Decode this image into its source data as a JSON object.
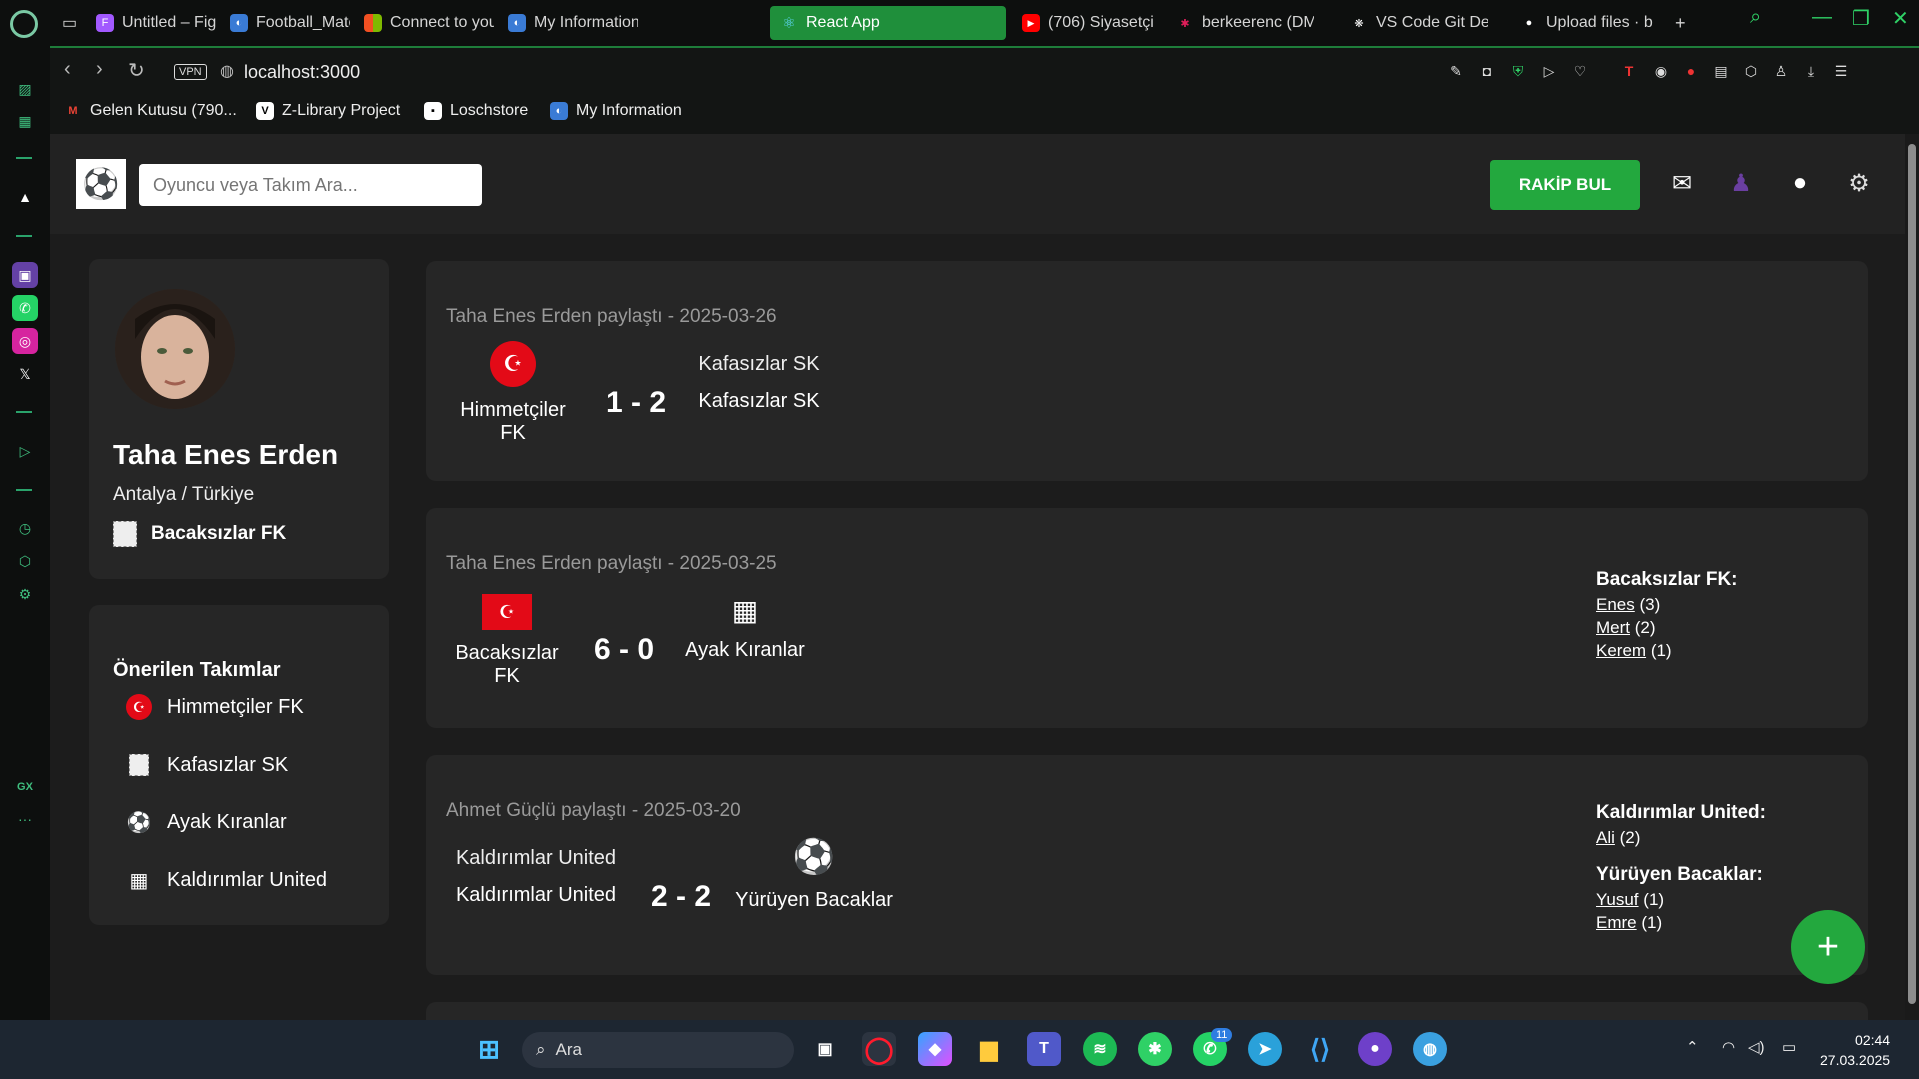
{
  "browser": {
    "tabs": [
      {
        "label": "Untitled – Figma",
        "icon": "figma-icon",
        "color": "#a259ff"
      },
      {
        "label": "Football_Match",
        "icon": "app-icon",
        "color": "#3a7bd5"
      },
      {
        "label": "Connect to you",
        "icon": "microsoft-icon",
        "color": "#f25022"
      },
      {
        "label": "My Information",
        "icon": "app-icon",
        "color": "#3a7bd5"
      },
      {
        "label": "React App",
        "icon": "react-icon",
        "color": "#61dafb"
      },
      {
        "label": "(706) Siyasetçi",
        "icon": "youtube-icon",
        "color": "#ff0000"
      },
      {
        "label": "berkeerenc (DM",
        "icon": "slack-icon",
        "color": "#e01e5a"
      },
      {
        "label": "VS Code Git De",
        "icon": "openai-icon",
        "color": "#ffffff"
      },
      {
        "label": "Upload files · b",
        "icon": "github-icon",
        "color": "#ffffff"
      }
    ],
    "url": "localhost:3000",
    "vpn_label": "VPN",
    "bookmarks": [
      {
        "label": "Gelen Kutusu (790...",
        "icon": "gmail-icon"
      },
      {
        "label": "Z-Library Project",
        "icon": "zlibrary-icon"
      },
      {
        "label": "Loschstore",
        "icon": "store-icon"
      },
      {
        "label": "My Information",
        "icon": "app-icon"
      }
    ],
    "sidebar_label": "GX"
  },
  "app": {
    "search_placeholder": "Oyuncu veya Takım Ara...",
    "rakip_button": "RAKİP BUL",
    "accent_color": "#23a83e",
    "profile": {
      "name": "Taha Enes Erden",
      "location": "Antalya / Türkiye",
      "team": "Bacaksızlar FK"
    },
    "suggested": {
      "title": "Önerilen Takımlar",
      "items": [
        {
          "name": "Himmetçiler FK",
          "icon": "turkey-flag-icon"
        },
        {
          "name": "Kafasızlar SK",
          "icon": "broken-image-icon"
        },
        {
          "name": "Ayak Kıranlar",
          "icon": "soccer-ball-icon"
        },
        {
          "name": "Kaldırımlar United",
          "icon": "goal-net-icon"
        }
      ]
    },
    "posts": [
      {
        "header": "Taha Enes Erden paylaştı - 2025-03-26",
        "home": "Himmetçiler FK",
        "away": "Kafasızlar SK",
        "away_alt": "Kafasızlar SK",
        "score": "1 - 2"
      },
      {
        "header": "Taha Enes Erden paylaştı - 2025-03-25",
        "home": "Bacaksızlar FK",
        "away": "Ayak Kıranlar",
        "score": "6 - 0",
        "scorers_title": "Bacaksızlar FK:",
        "scorers": [
          {
            "name": "Enes",
            "count": "(3)"
          },
          {
            "name": "Mert",
            "count": "(2)"
          },
          {
            "name": "Kerem",
            "count": "(1)"
          }
        ]
      },
      {
        "header": "Ahmet Güçlü paylaştı - 2025-03-20",
        "home": "Kaldırımlar United",
        "home_alt": "Kaldırımlar United",
        "away": "Yürüyen Bacaklar",
        "score": "2 - 2",
        "scorers_title": "Kaldırımlar United:",
        "scorers": [
          {
            "name": "Ali",
            "count": "(2)"
          }
        ],
        "scorers_title_2": "Yürüyen Bacaklar:",
        "scorers_2": [
          {
            "name": "Yusuf",
            "count": "(1)"
          },
          {
            "name": "Emre",
            "count": "(1)"
          }
        ]
      }
    ],
    "fab_label": "+"
  },
  "taskbar": {
    "search_label": "Ara",
    "whatsapp_badge": "11",
    "time": "02:44",
    "date": "27.03.2025"
  }
}
